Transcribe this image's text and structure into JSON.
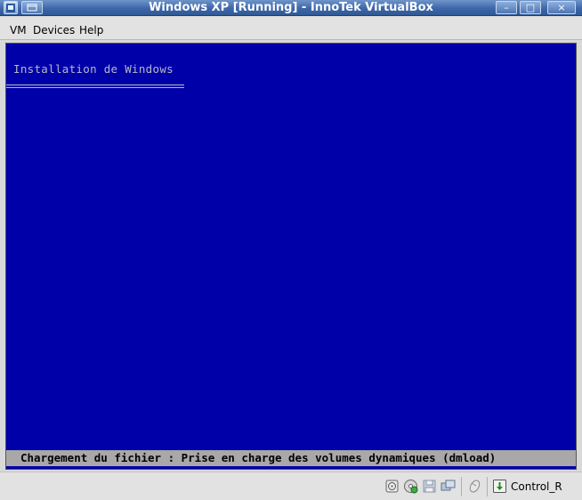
{
  "window": {
    "title": "Windows XP [Running] - InnoTek VirtualBox",
    "minimize_glyph": "–",
    "maximize_glyph": "□",
    "close_glyph": "×"
  },
  "menu": {
    "items": [
      {
        "label": "VM"
      },
      {
        "label": "Devices"
      },
      {
        "label": "Help"
      }
    ]
  },
  "vm_screen": {
    "background": "#0000a8",
    "heading": "Installation de Windows",
    "status_line": "Chargement du fichier : Prise en charge des volumes dynamiques (dmload)"
  },
  "statusbar": {
    "icons": [
      "hard-disk-icon",
      "cd-rom-icon",
      "floppy-icon",
      "network-icon",
      "mouse-integration-icon",
      "host-key-icon"
    ],
    "host_key": "Control_R"
  }
}
